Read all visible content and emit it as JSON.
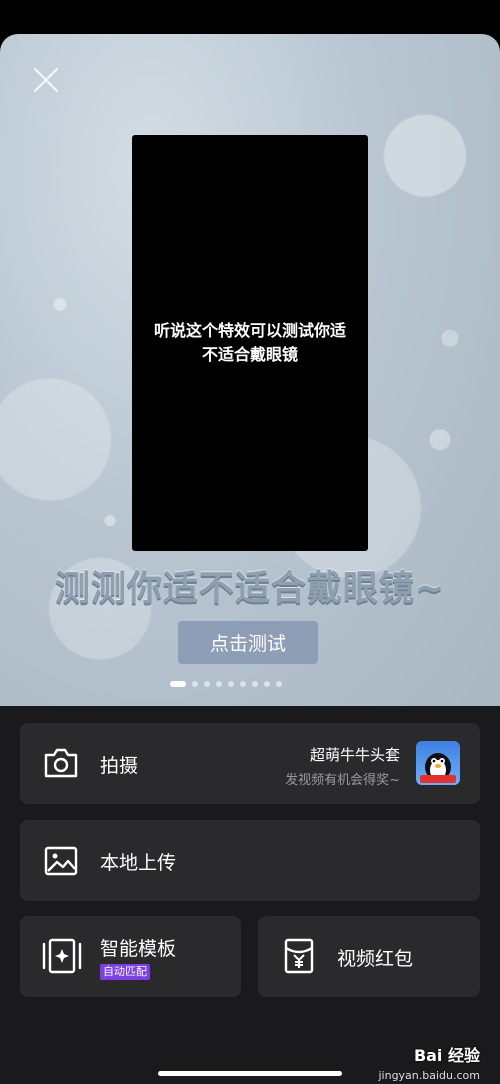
{
  "banner": {
    "video_caption": "听说这个特效可以测试你适不适合戴眼镜",
    "headline": "测测你适不适合戴眼镜~",
    "test_button": "点击测试",
    "dots_total": 9,
    "dots_active_index": 0
  },
  "actions": {
    "shoot": {
      "label": "拍摄",
      "icon": "camera-icon"
    },
    "promo": {
      "title": "超萌牛牛头套",
      "subtitle": "发视频有机会得奖~"
    },
    "upload": {
      "label": "本地上传",
      "icon": "image-icon"
    },
    "template": {
      "label": "智能模板",
      "badge": "自动匹配",
      "icon": "template-icon"
    },
    "red_packet": {
      "label": "视频红包",
      "icon": "red-packet-icon"
    }
  },
  "watermark": {
    "brand": "Bai 经验",
    "url": "jingyan.baidu.com"
  },
  "colors": {
    "sheet_bg": "#1a1a1c",
    "card_bg": "#2a2a2d",
    "badge_purple": "#7b3fe4",
    "test_button_bg": "#8e9eb7"
  }
}
